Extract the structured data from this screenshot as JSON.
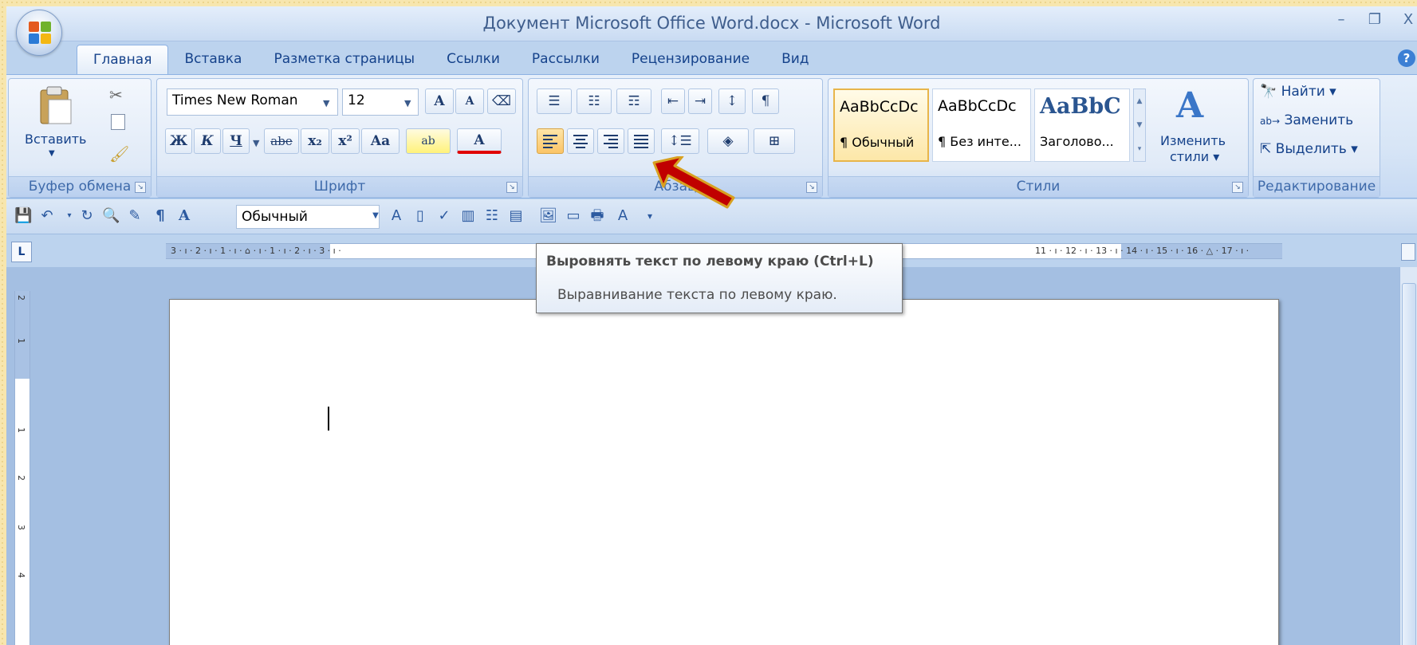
{
  "window": {
    "title": "Документ Microsoft Office Word.docx - Microsoft Word",
    "controls": {
      "minimize": "–",
      "restore": "❐",
      "close": "X"
    }
  },
  "tabs": [
    {
      "label": "Главная",
      "active": true
    },
    {
      "label": "Вставка"
    },
    {
      "label": "Разметка страницы"
    },
    {
      "label": "Ссылки"
    },
    {
      "label": "Рассылки"
    },
    {
      "label": "Рецензирование"
    },
    {
      "label": "Вид"
    }
  ],
  "ribbon": {
    "clipboard": {
      "label": "Буфер обмена",
      "paste_label": "Вставить"
    },
    "font": {
      "label": "Шрифт",
      "font_name": "Times New Roman",
      "font_size": "12",
      "bold": "Ж",
      "italic": "К",
      "underline": "Ч",
      "strike": "abe",
      "subscript": "x₂",
      "superscript": "x²",
      "case": "Aa",
      "grow": "A",
      "shrink": "A",
      "highlight": "ab",
      "color": "A"
    },
    "paragraph": {
      "label": "Абзац"
    },
    "styles": {
      "label": "Стили",
      "items": [
        {
          "sample": "AaBbCcDc",
          "name": "¶ Обычный"
        },
        {
          "sample": "AaBbCcDc",
          "name": "¶ Без инте..."
        },
        {
          "sample": "AaBbC",
          "name": "Заголово..."
        }
      ],
      "change_styles_line1": "Изменить",
      "change_styles_line2": "стили"
    },
    "editing": {
      "label": "Редактирование",
      "find": "Найти",
      "replace": "Заменить",
      "select": "Выделить"
    }
  },
  "qat": {
    "style_value": "Обычный"
  },
  "ruler": {
    "left_text": "3 · ı · 2 · ı · 1 · ı · ⌂ · ı · 1 · ı · 2 · ı · 3 · ı ·",
    "right_text": "11 · ı · 12 · ı · 13 · ı · 14 · ı · 15 · ı · 16 · △ · 17 · ı ·"
  },
  "vruler_numbers": [
    "2",
    "1",
    "1",
    "2",
    "3",
    "4"
  ],
  "tooltip": {
    "title": "Выровнять текст по левому краю (Ctrl+L)",
    "description": "Выравнивание текста по левому краю."
  },
  "colors": {
    "accent": "#15428b",
    "active_button": "#fbc467",
    "arrow": "#c00000"
  }
}
